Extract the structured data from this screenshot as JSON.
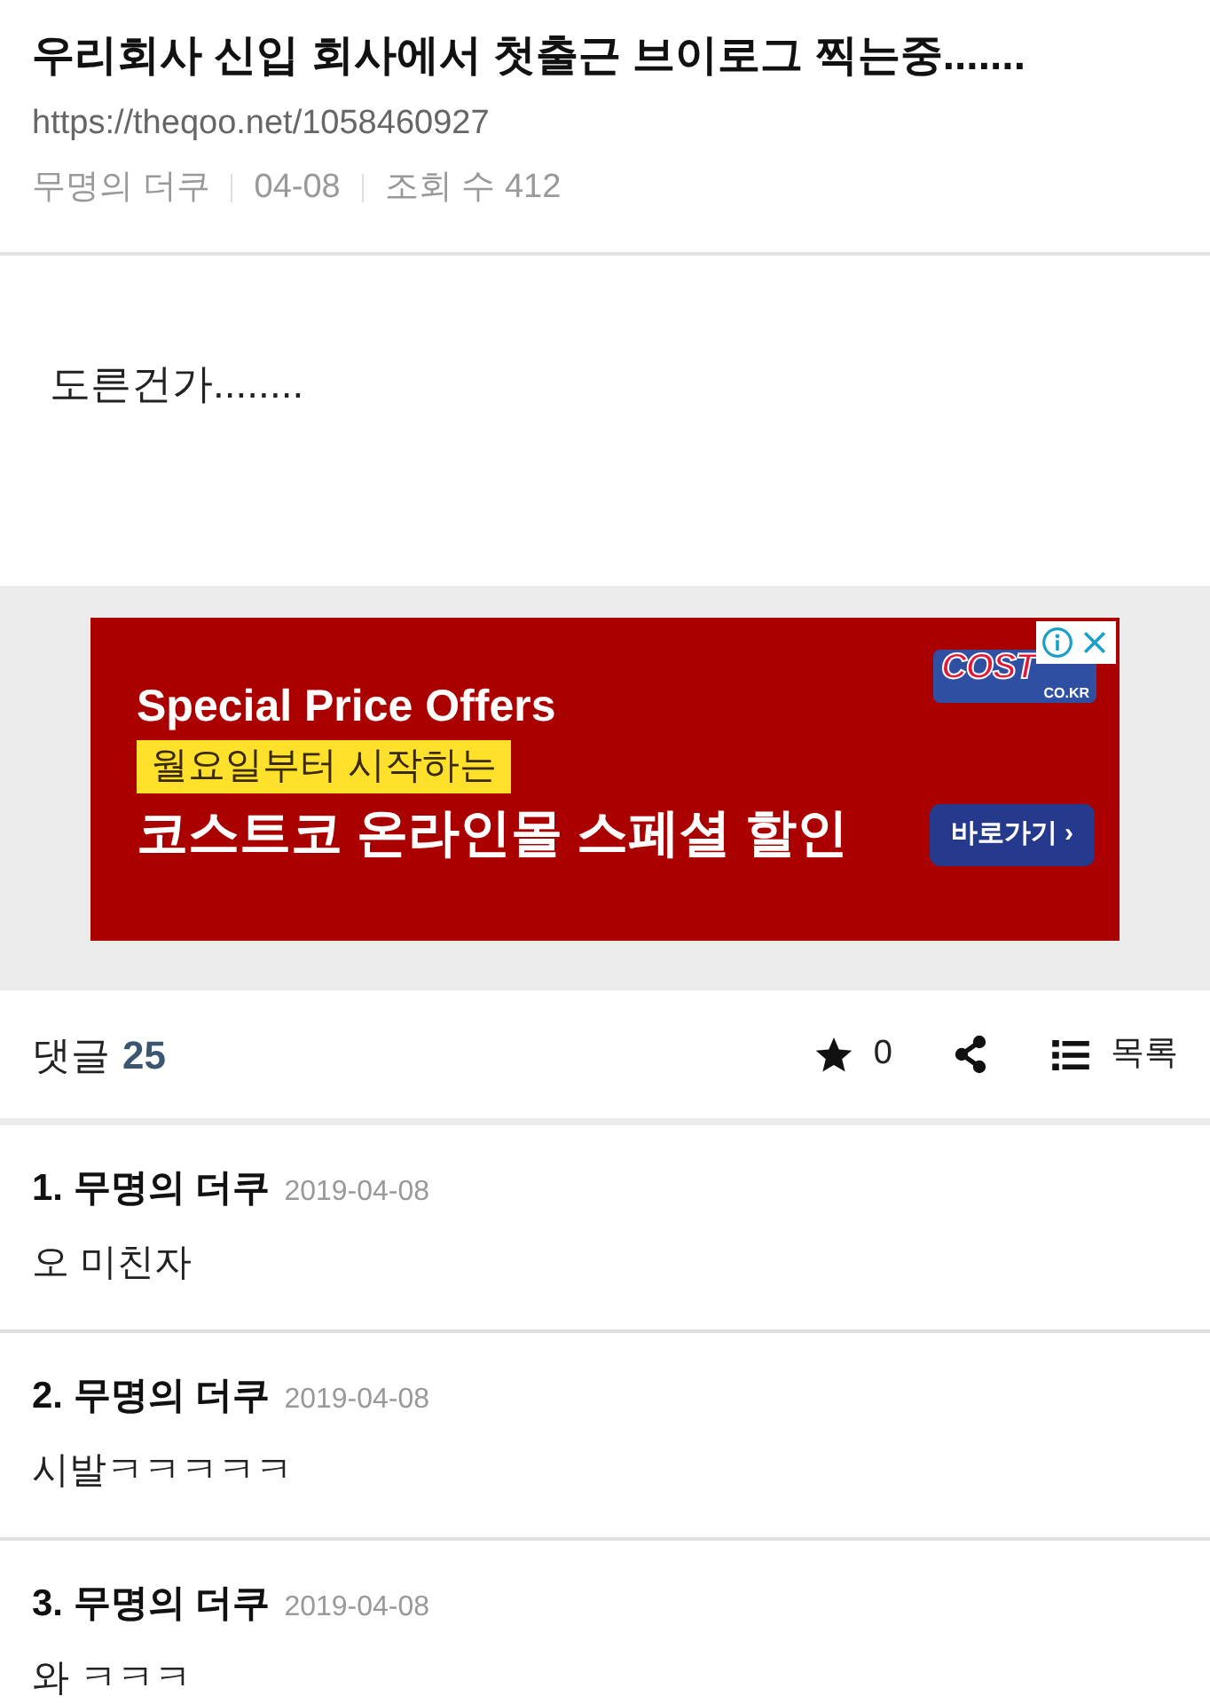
{
  "post": {
    "title": "우리회사 신입 회사에서 첫출근 브이로그 찍는중.......",
    "url": "https://theqoo.net/1058460927",
    "meta": [
      "무명의 더쿠",
      "04-08",
      "조회 수 412"
    ]
  },
  "body": {
    "text": "도른건가........"
  },
  "ad": {
    "logo_text": "COST",
    "logo_subtext": "CO.KR",
    "headline": "Special Price Offers",
    "highlight": "월요일부터 시작하는",
    "tagline": "코스트코 온라인몰 스페셜 할인",
    "button": "바로가기 ›"
  },
  "comment_bar": {
    "label": "댓글",
    "count": "25",
    "vote_count": "0",
    "list_label": "목록"
  },
  "comments": [
    {
      "number": "1.",
      "author": "무명의 더쿠",
      "date": "2019-04-08",
      "text": "오 미친자"
    },
    {
      "number": "2.",
      "author": "무명의 더쿠",
      "date": "2019-04-08",
      "text": "시발ㅋㅋㅋㅋㅋ"
    },
    {
      "number": "3.",
      "author": "무명의 더쿠",
      "date": "2019-04-08",
      "text": "와 ㅋㅋㅋ"
    }
  ]
}
